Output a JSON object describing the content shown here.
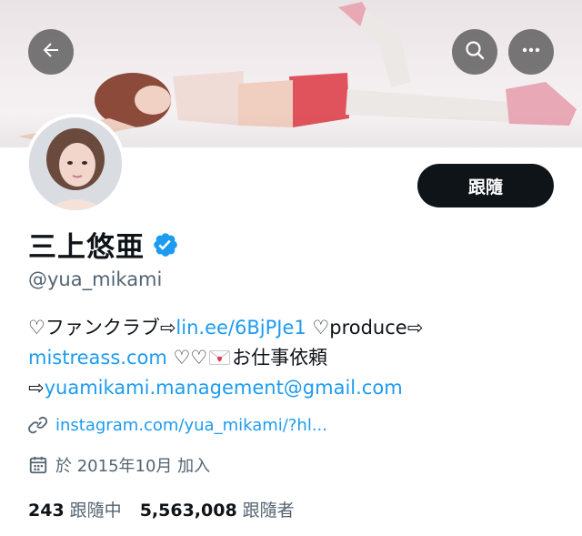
{
  "profile": {
    "follow_label": "跟隨",
    "display_name": "三上悠亜",
    "handle": "@yua_mikami",
    "bio": {
      "line1_prefix": "♡ファンクラブ⇨",
      "line1_link": "lin.ee/6BjPJe1",
      "line1_suffix": " ♡produce⇨",
      "line2_link": "mistreass.com",
      "line2_mid": " ♡♡",
      "line2_suffix": "お仕事依頼",
      "line3_prefix": "⇨",
      "line3_link": "yuamikami.management@gmail.com"
    },
    "website": "instagram.com/yua_mikami/?hl...",
    "joined": "於 2015年10月 加入",
    "following_count": "243",
    "following_label": "跟隨中",
    "followers_count": "5,563,008",
    "followers_label": "跟隨者"
  },
  "icons": {
    "back": "arrow-left-icon",
    "search": "search-icon",
    "more": "more-horizontal-icon",
    "verified": "verified-badge-icon",
    "link": "link-icon",
    "calendar": "calendar-icon",
    "mail": "love-letter-icon"
  },
  "colors": {
    "accent": "#1d9bf0",
    "text": "#0f1419",
    "secondary": "#536471",
    "button": "#0f1419"
  }
}
